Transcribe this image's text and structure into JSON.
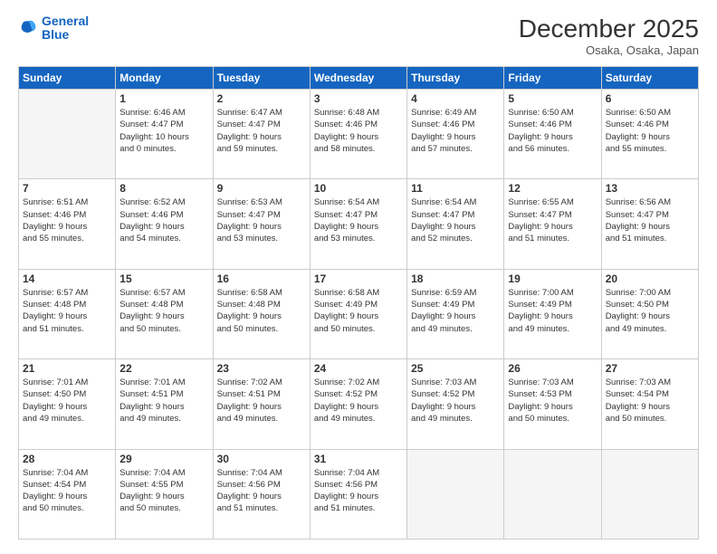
{
  "logo": {
    "line1": "General",
    "line2": "Blue"
  },
  "title": "December 2025",
  "location": "Osaka, Osaka, Japan",
  "weekdays": [
    "Sunday",
    "Monday",
    "Tuesday",
    "Wednesday",
    "Thursday",
    "Friday",
    "Saturday"
  ],
  "weeks": [
    [
      {
        "day": "",
        "info": ""
      },
      {
        "day": "1",
        "info": "Sunrise: 6:46 AM\nSunset: 4:47 PM\nDaylight: 10 hours\nand 0 minutes."
      },
      {
        "day": "2",
        "info": "Sunrise: 6:47 AM\nSunset: 4:47 PM\nDaylight: 9 hours\nand 59 minutes."
      },
      {
        "day": "3",
        "info": "Sunrise: 6:48 AM\nSunset: 4:46 PM\nDaylight: 9 hours\nand 58 minutes."
      },
      {
        "day": "4",
        "info": "Sunrise: 6:49 AM\nSunset: 4:46 PM\nDaylight: 9 hours\nand 57 minutes."
      },
      {
        "day": "5",
        "info": "Sunrise: 6:50 AM\nSunset: 4:46 PM\nDaylight: 9 hours\nand 56 minutes."
      },
      {
        "day": "6",
        "info": "Sunrise: 6:50 AM\nSunset: 4:46 PM\nDaylight: 9 hours\nand 55 minutes."
      }
    ],
    [
      {
        "day": "7",
        "info": "Sunrise: 6:51 AM\nSunset: 4:46 PM\nDaylight: 9 hours\nand 55 minutes."
      },
      {
        "day": "8",
        "info": "Sunrise: 6:52 AM\nSunset: 4:46 PM\nDaylight: 9 hours\nand 54 minutes."
      },
      {
        "day": "9",
        "info": "Sunrise: 6:53 AM\nSunset: 4:47 PM\nDaylight: 9 hours\nand 53 minutes."
      },
      {
        "day": "10",
        "info": "Sunrise: 6:54 AM\nSunset: 4:47 PM\nDaylight: 9 hours\nand 53 minutes."
      },
      {
        "day": "11",
        "info": "Sunrise: 6:54 AM\nSunset: 4:47 PM\nDaylight: 9 hours\nand 52 minutes."
      },
      {
        "day": "12",
        "info": "Sunrise: 6:55 AM\nSunset: 4:47 PM\nDaylight: 9 hours\nand 51 minutes."
      },
      {
        "day": "13",
        "info": "Sunrise: 6:56 AM\nSunset: 4:47 PM\nDaylight: 9 hours\nand 51 minutes."
      }
    ],
    [
      {
        "day": "14",
        "info": "Sunrise: 6:57 AM\nSunset: 4:48 PM\nDaylight: 9 hours\nand 51 minutes."
      },
      {
        "day": "15",
        "info": "Sunrise: 6:57 AM\nSunset: 4:48 PM\nDaylight: 9 hours\nand 50 minutes."
      },
      {
        "day": "16",
        "info": "Sunrise: 6:58 AM\nSunset: 4:48 PM\nDaylight: 9 hours\nand 50 minutes."
      },
      {
        "day": "17",
        "info": "Sunrise: 6:58 AM\nSunset: 4:49 PM\nDaylight: 9 hours\nand 50 minutes."
      },
      {
        "day": "18",
        "info": "Sunrise: 6:59 AM\nSunset: 4:49 PM\nDaylight: 9 hours\nand 49 minutes."
      },
      {
        "day": "19",
        "info": "Sunrise: 7:00 AM\nSunset: 4:49 PM\nDaylight: 9 hours\nand 49 minutes."
      },
      {
        "day": "20",
        "info": "Sunrise: 7:00 AM\nSunset: 4:50 PM\nDaylight: 9 hours\nand 49 minutes."
      }
    ],
    [
      {
        "day": "21",
        "info": "Sunrise: 7:01 AM\nSunset: 4:50 PM\nDaylight: 9 hours\nand 49 minutes."
      },
      {
        "day": "22",
        "info": "Sunrise: 7:01 AM\nSunset: 4:51 PM\nDaylight: 9 hours\nand 49 minutes."
      },
      {
        "day": "23",
        "info": "Sunrise: 7:02 AM\nSunset: 4:51 PM\nDaylight: 9 hours\nand 49 minutes."
      },
      {
        "day": "24",
        "info": "Sunrise: 7:02 AM\nSunset: 4:52 PM\nDaylight: 9 hours\nand 49 minutes."
      },
      {
        "day": "25",
        "info": "Sunrise: 7:03 AM\nSunset: 4:52 PM\nDaylight: 9 hours\nand 49 minutes."
      },
      {
        "day": "26",
        "info": "Sunrise: 7:03 AM\nSunset: 4:53 PM\nDaylight: 9 hours\nand 50 minutes."
      },
      {
        "day": "27",
        "info": "Sunrise: 7:03 AM\nSunset: 4:54 PM\nDaylight: 9 hours\nand 50 minutes."
      }
    ],
    [
      {
        "day": "28",
        "info": "Sunrise: 7:04 AM\nSunset: 4:54 PM\nDaylight: 9 hours\nand 50 minutes."
      },
      {
        "day": "29",
        "info": "Sunrise: 7:04 AM\nSunset: 4:55 PM\nDaylight: 9 hours\nand 50 minutes."
      },
      {
        "day": "30",
        "info": "Sunrise: 7:04 AM\nSunset: 4:56 PM\nDaylight: 9 hours\nand 51 minutes."
      },
      {
        "day": "31",
        "info": "Sunrise: 7:04 AM\nSunset: 4:56 PM\nDaylight: 9 hours\nand 51 minutes."
      },
      {
        "day": "",
        "info": ""
      },
      {
        "day": "",
        "info": ""
      },
      {
        "day": "",
        "info": ""
      }
    ]
  ]
}
